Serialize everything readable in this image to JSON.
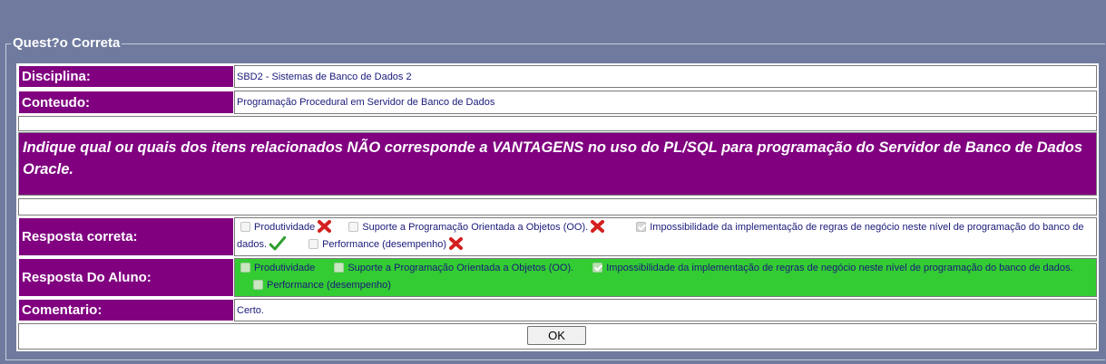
{
  "legend": "Quest?o Correta",
  "disciplina": {
    "label": "Disciplina:",
    "value": "SBD2 - Sistemas de Banco de Dados 2"
  },
  "conteudo": {
    "label": "Conteudo:",
    "value": "Programação Procedural em Servidor de Banco de Dados"
  },
  "question": "Indique qual ou quais dos itens relacionados NÃO corresponde a VANTAGENS no uso do PL/SQL para programação do Servidor de Banco de Dados Oracle.",
  "resposta_correta": {
    "label": "Resposta correta:",
    "options": [
      {
        "text": "Produtividade",
        "checked": false,
        "mark": "x-icon"
      },
      {
        "text": "Suporte a Programação Orientada a Objetos (OO).",
        "checked": false,
        "mark": "x-icon"
      },
      {
        "text": "Impossibilidade da implementação de regras de negócio neste nível de programação do banco de dados.",
        "checked": true,
        "mark": "check-icon"
      },
      {
        "text": "Performance (desempenho)",
        "checked": false,
        "mark": "x-icon"
      }
    ]
  },
  "resposta_aluno": {
    "label": "Resposta Do Aluno:",
    "options": [
      {
        "text": "Produtividade",
        "checked": false
      },
      {
        "text": "Suporte a Programação Orientada a Objetos (OO).",
        "checked": false
      },
      {
        "text": "Impossibilidade da implementação de regras de negócio neste nível de programação do banco de dados.",
        "checked": true
      },
      {
        "text": "Performance (desempenho)",
        "checked": false
      }
    ]
  },
  "comentario": {
    "label": "Comentario:",
    "value": "Certo."
  },
  "ok_label": "OK",
  "colors": {
    "label_bg": "#800080",
    "student_bg": "#33cc33",
    "page_bg": "#6f7a9e"
  }
}
